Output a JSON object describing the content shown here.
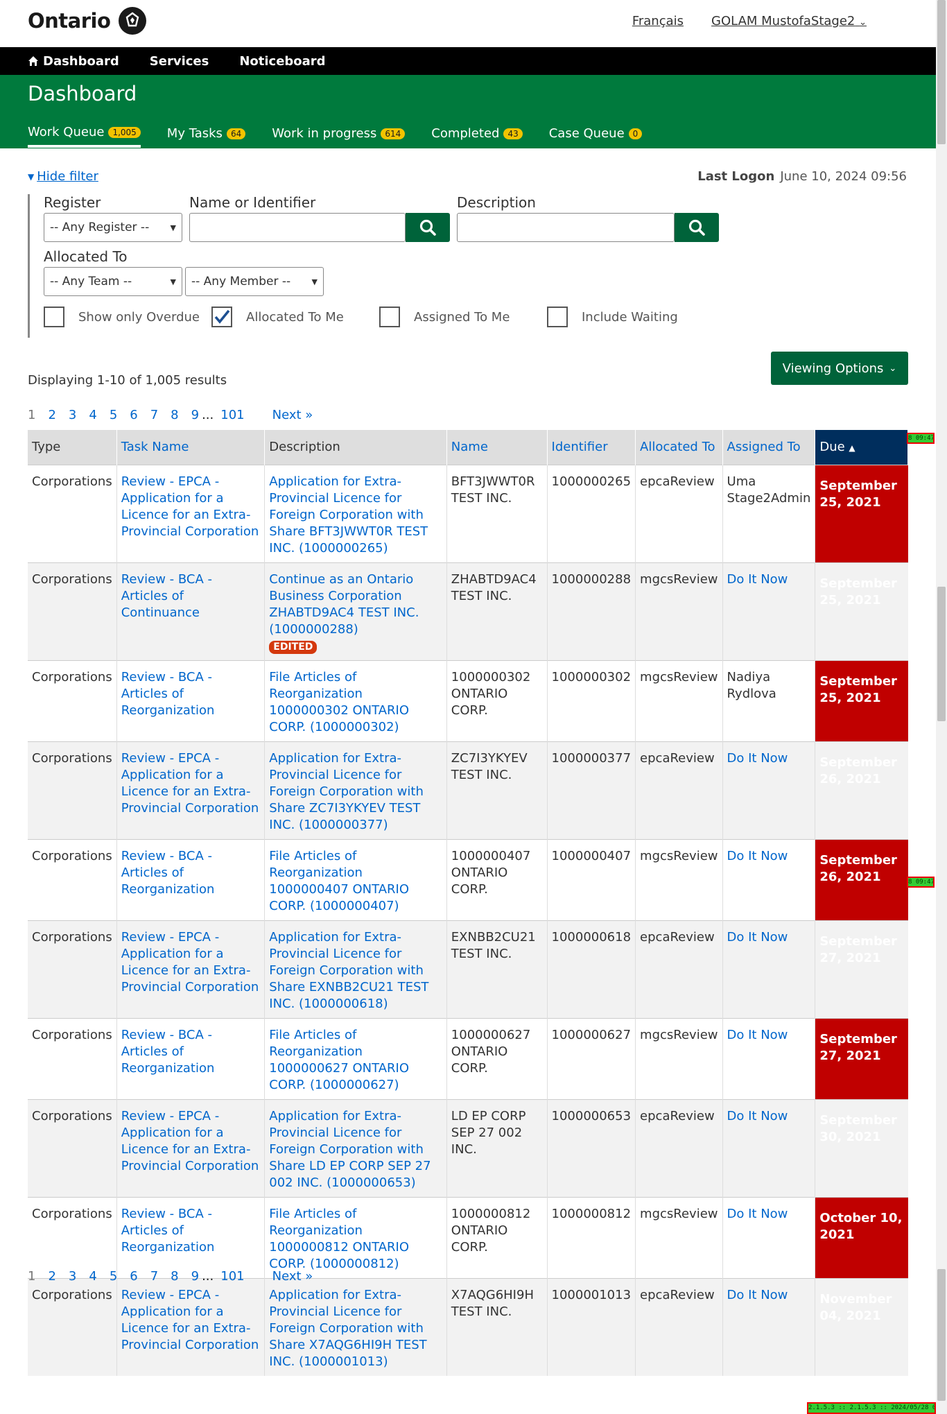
{
  "header": {
    "logo_text": "Ontario",
    "lang_link": "Français",
    "user_menu": "GOLAM MustofaStage2"
  },
  "nav": {
    "items": [
      "Dashboard",
      "Services",
      "Noticeboard"
    ]
  },
  "dashboard": {
    "title": "Dashboard",
    "tabs": [
      {
        "label": "Work Queue",
        "count": "1,005"
      },
      {
        "label": "My Tasks",
        "count": "64"
      },
      {
        "label": "Work in progress",
        "count": "614"
      },
      {
        "label": "Completed",
        "count": "43"
      },
      {
        "label": "Case Queue",
        "count": "0"
      }
    ]
  },
  "filter": {
    "hide_label": "Hide filter",
    "last_logon_label": "Last Logon",
    "last_logon_value": "June 10, 2024 09:56",
    "register_label": "Register",
    "register_value": "-- Any Register --",
    "name_label": "Name or Identifier",
    "description_label": "Description",
    "allocated_label": "Allocated To",
    "team_value": "-- Any Team --",
    "member_value": "-- Any Member --",
    "checkboxes": [
      {
        "label": "Show only Overdue",
        "checked": false
      },
      {
        "label": "Allocated To Me",
        "checked": true
      },
      {
        "label": "Assigned To Me",
        "checked": false
      },
      {
        "label": "Include Waiting",
        "checked": false
      }
    ]
  },
  "viewing_options": "Viewing Options",
  "results_text": "Displaying 1-10 of 1,005 results",
  "pager": {
    "current": "1",
    "pages": [
      "2",
      "3",
      "4",
      "5",
      "6",
      "7",
      "8",
      "9"
    ],
    "ellipsis": "...",
    "last": "101",
    "next": "Next »"
  },
  "table": {
    "headers": [
      "Type",
      "Task Name",
      "Description",
      "Name",
      "Identifier",
      "Allocated To",
      "Assigned To",
      "Due"
    ],
    "rows": [
      {
        "type": "Corporations",
        "task": "Review - EPCA - Application for a Licence for an Extra-Provincial Corporation",
        "desc": "Application for Extra-Provincial Licence for Foreign Corporation with Share BFT3JWWT0R TEST INC. (1000000265)",
        "edited": "",
        "name": "BFT3JWWT0R TEST INC.",
        "id": "1000000265",
        "alloc": "epcaReview",
        "assigned": "Uma Stage2Admin",
        "assigned_link": false,
        "due": "September 25, 2021"
      },
      {
        "type": "Corporations",
        "task": "Review - BCA - Articles of Continuance",
        "desc": "Continue as an Ontario Business Corporation ZHABTD9AC4 TEST INC. (1000000288)",
        "edited": "EDITED",
        "name": "ZHABTD9AC4 TEST INC.",
        "id": "1000000288",
        "alloc": "mgcsReview",
        "assigned": "Do It Now",
        "assigned_link": true,
        "due": "September 25, 2021"
      },
      {
        "type": "Corporations",
        "task": "Review - BCA - Articles of Reorganization",
        "desc": "File Articles of Reorganization 1000000302 ONTARIO CORP. (1000000302)",
        "edited": "",
        "name": "1000000302 ONTARIO CORP.",
        "id": "1000000302",
        "alloc": "mgcsReview",
        "assigned": "Nadiya Rydlova",
        "assigned_link": false,
        "due": "September 25, 2021"
      },
      {
        "type": "Corporations",
        "task": "Review - EPCA - Application for a Licence for an Extra-Provincial Corporation",
        "desc": "Application for Extra-Provincial Licence for Foreign Corporation with Share ZC7I3YKYEV TEST INC. (1000000377)",
        "edited": "",
        "name": "ZC7I3YKYEV TEST INC.",
        "id": "1000000377",
        "alloc": "epcaReview",
        "assigned": "Do It Now",
        "assigned_link": true,
        "due": "September 26, 2021"
      },
      {
        "type": "Corporations",
        "task": "Review - BCA - Articles of Reorganization",
        "desc": "File Articles of Reorganization 1000000407 ONTARIO CORP. (1000000407)",
        "edited": "",
        "name": "1000000407 ONTARIO CORP.",
        "id": "1000000407",
        "alloc": "mgcsReview",
        "assigned": "Do It Now",
        "assigned_link": true,
        "due": "September 26, 2021"
      },
      {
        "type": "Corporations",
        "task": "Review - EPCA - Application for a Licence for an Extra-Provincial Corporation",
        "desc": "Application for Extra-Provincial Licence for Foreign Corporation with Share EXNBB2CU21 TEST INC. (1000000618)",
        "edited": "",
        "name": "EXNBB2CU21 TEST INC.",
        "id": "1000000618",
        "alloc": "epcaReview",
        "assigned": "Do It Now",
        "assigned_link": true,
        "due": "September 27, 2021"
      },
      {
        "type": "Corporations",
        "task": "Review - BCA - Articles of Reorganization",
        "desc": "File Articles of Reorganization 1000000627 ONTARIO CORP. (1000000627)",
        "edited": "",
        "name": "1000000627 ONTARIO CORP.",
        "id": "1000000627",
        "alloc": "mgcsReview",
        "assigned": "Do It Now",
        "assigned_link": true,
        "due": "September 27, 2021"
      },
      {
        "type": "Corporations",
        "task": "Review - EPCA - Application for a Licence for an Extra-Provincial Corporation",
        "desc": "Application for Extra-Provincial Licence for Foreign Corporation with Share LD EP CORP SEP 27 002 INC. (1000000653)",
        "edited": "",
        "name": "LD EP CORP SEP 27 002 INC.",
        "id": "1000000653",
        "alloc": "epcaReview",
        "assigned": "Do It Now",
        "assigned_link": true,
        "due": "September 30, 2021"
      },
      {
        "type": "Corporations",
        "task": "Review - BCA - Articles of Reorganization",
        "desc": "File Articles of Reorganization 1000000812 ONTARIO CORP. (1000000812)",
        "edited": "",
        "name": "1000000812 ONTARIO CORP.",
        "id": "1000000812",
        "alloc": "mgcsReview",
        "assigned": "Do It Now",
        "assigned_link": true,
        "due": "October 10, 2021"
      },
      {
        "type": "Corporations",
        "task": "Review - EPCA - Application for a Licence for an Extra-Provincial Corporation",
        "desc": "Application for Extra-Provincial Licence for Foreign Corporation with Share X7AQG6HI9H TEST INC. (1000001013)",
        "edited": "",
        "name": "X7AQG6HI9H TEST INC.",
        "id": "1000001013",
        "alloc": "epcaReview",
        "assigned": "Do It Now",
        "assigned_link": true,
        "due": "November 04, 2021"
      }
    ]
  },
  "debug": {
    "tag1": "8 09:47",
    "tag2": "8 09:47",
    "footer": "2.1.5.3 :: 2.1.5.3 :: 2024/05/28 09:47"
  },
  "colors": {
    "ontario_green": "#007a3d",
    "button_green": "#00633a",
    "overdue_red": "#c00000",
    "due_header": "#002e5d",
    "badge_yellow": "#f2c300"
  }
}
